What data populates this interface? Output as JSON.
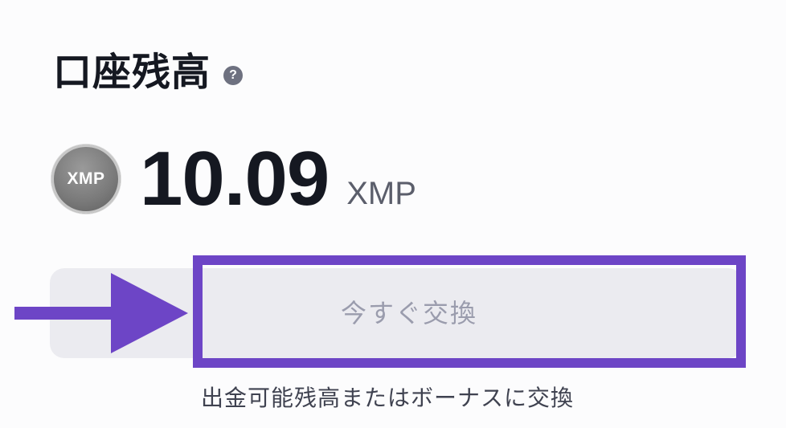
{
  "balance_card": {
    "title": "口座残高",
    "help_icon_glyph": "?",
    "coin": {
      "label": "XMP",
      "icon": "xmp-coin-icon"
    },
    "amount": "10.09",
    "unit": "XMP"
  },
  "exchange": {
    "button_label": "今すぐ交換",
    "description": "出金可能残高またはボーナスに交換"
  },
  "colors": {
    "highlight_border": "#6d45c6",
    "arrow": "#6d45c6",
    "button_background": "#ebebf0",
    "button_text": "#9a9cad",
    "title_text": "#151821"
  }
}
